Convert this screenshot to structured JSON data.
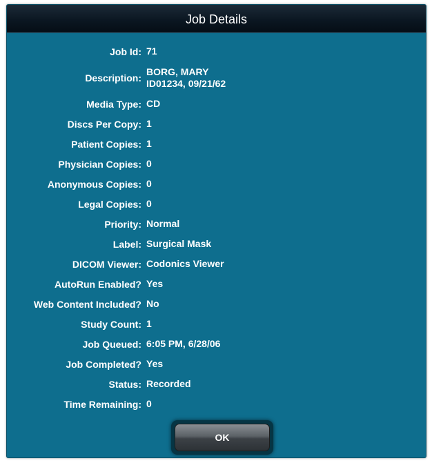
{
  "dialog": {
    "title": "Job Details",
    "ok_label": "OK"
  },
  "details": [
    {
      "label": "Job Id:",
      "value": [
        "71"
      ]
    },
    {
      "label": "Description:",
      "value": [
        "BORG, MARY",
        "ID01234, 09/21/62"
      ]
    },
    {
      "label": "Media Type:",
      "value": [
        "CD"
      ]
    },
    {
      "label": "Discs Per Copy:",
      "value": [
        "1"
      ]
    },
    {
      "label": "Patient Copies:",
      "value": [
        "1"
      ]
    },
    {
      "label": "Physician Copies:",
      "value": [
        "0"
      ]
    },
    {
      "label": "Anonymous Copies:",
      "value": [
        "0"
      ]
    },
    {
      "label": "Legal Copies:",
      "value": [
        "0"
      ]
    },
    {
      "label": "Priority:",
      "value": [
        "Normal"
      ]
    },
    {
      "label": "Label:",
      "value": [
        "Surgical Mask"
      ]
    },
    {
      "label": "DICOM Viewer:",
      "value": [
        "Codonics Viewer"
      ]
    },
    {
      "label": "AutoRun Enabled?",
      "value": [
        "Yes"
      ]
    },
    {
      "label": "Web Content Included?",
      "value": [
        "No"
      ]
    },
    {
      "label": "Study Count:",
      "value": [
        "1"
      ]
    },
    {
      "label": "Job Queued:",
      "value": [
        "6:05 PM, 6/28/06"
      ]
    },
    {
      "label": "Job Completed?",
      "value": [
        "Yes"
      ]
    },
    {
      "label": "Status:",
      "value": [
        "Recorded"
      ]
    },
    {
      "label": "Time Remaining:",
      "value": [
        "0"
      ]
    }
  ]
}
